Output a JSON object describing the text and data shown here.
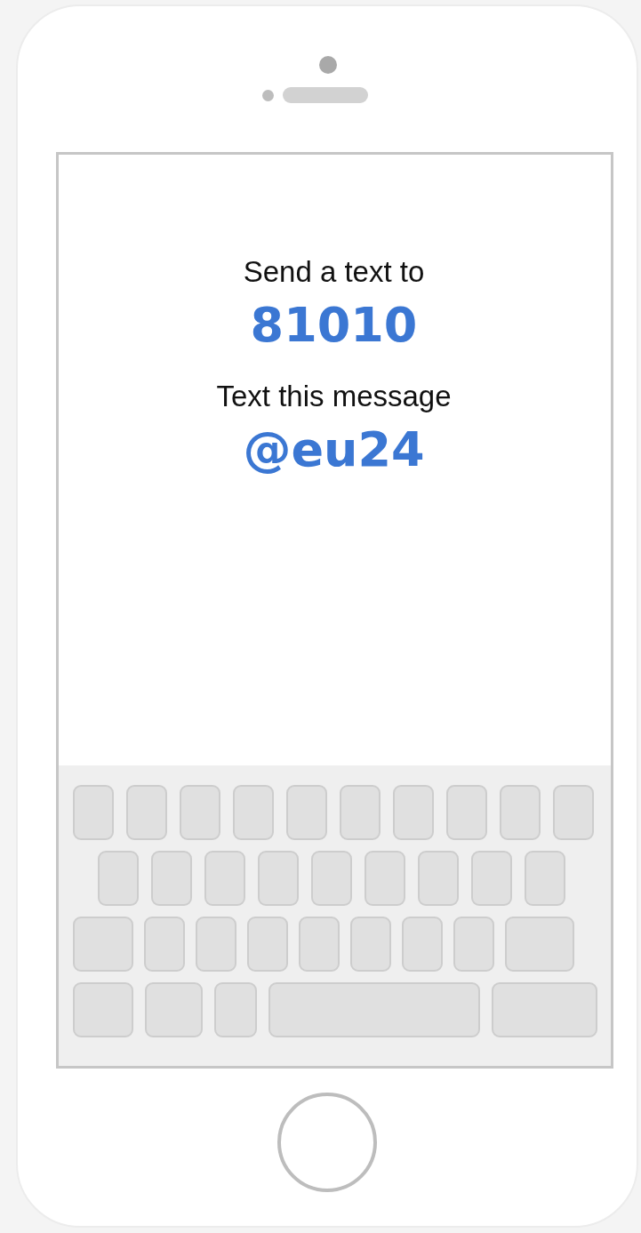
{
  "screen": {
    "lines": [
      {
        "kind": "label",
        "text": "Send a text to"
      },
      {
        "kind": "value",
        "text": "81010"
      },
      {
        "kind": "label",
        "text": "Text this message"
      },
      {
        "kind": "value",
        "text": "@eu24"
      }
    ]
  }
}
